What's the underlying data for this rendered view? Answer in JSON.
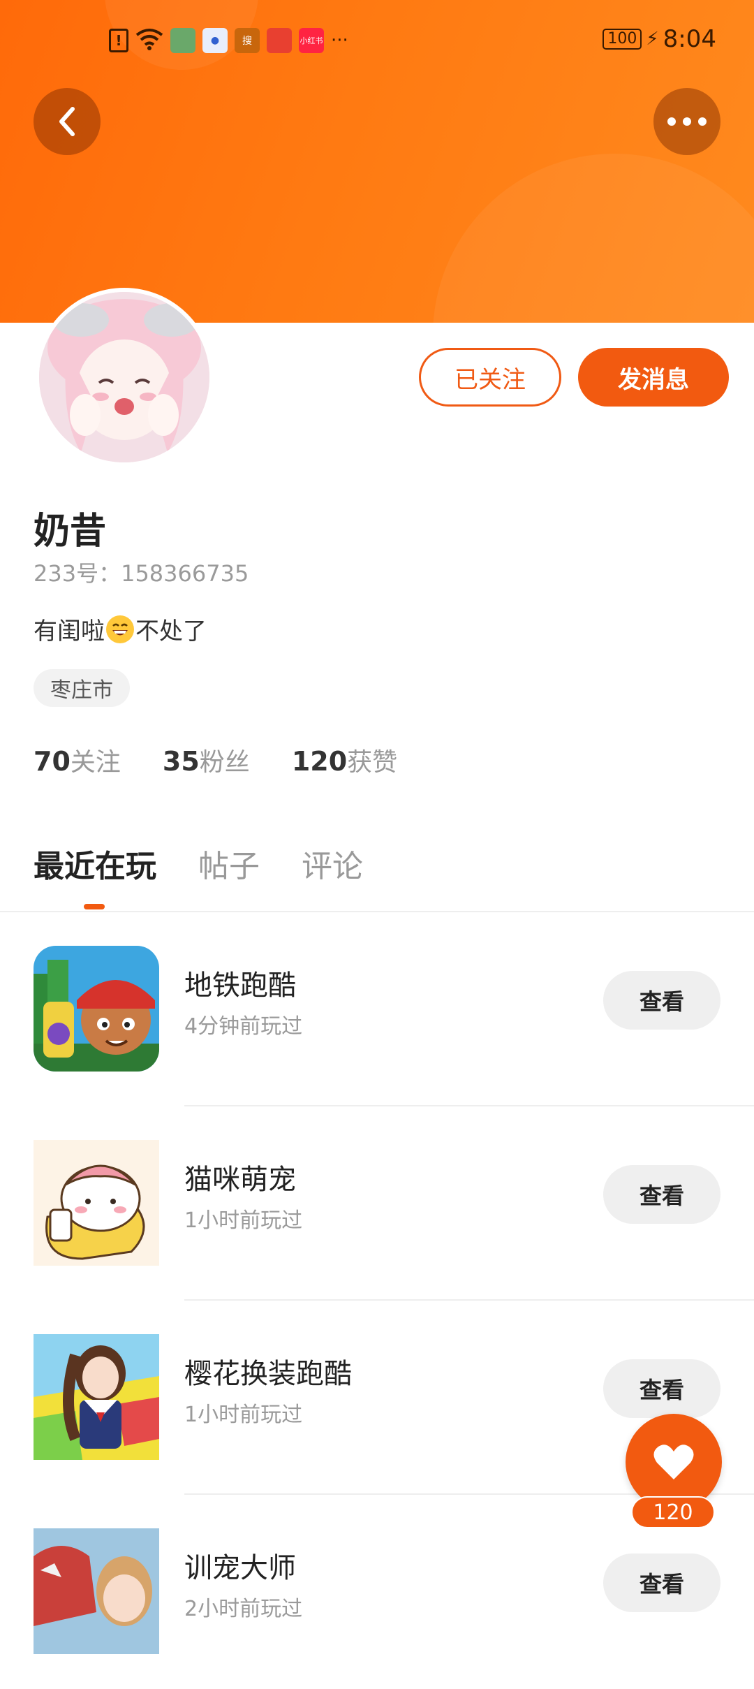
{
  "status_bar": {
    "time": "8:04",
    "battery": "100",
    "more": "···",
    "app_badges": [
      "搜",
      "小红书"
    ]
  },
  "profile": {
    "name": "奶昔",
    "uid": "233号：158366735",
    "bio_before": "有闺啦",
    "bio_after": "不处了",
    "location": "枣庄市",
    "follow_button": "已关注",
    "message_button": "发消息"
  },
  "stats": [
    {
      "value": "70",
      "label": "关注"
    },
    {
      "value": "35",
      "label": "粉丝"
    },
    {
      "value": "120",
      "label": "获赞"
    }
  ],
  "tabs": [
    {
      "label": "最近在玩",
      "active": true
    },
    {
      "label": "帖子",
      "active": false
    },
    {
      "label": "评论",
      "active": false
    }
  ],
  "games": [
    {
      "name": "地铁跑酷",
      "time": "4分钟前玩过",
      "button": "查看"
    },
    {
      "name": "猫咪萌宠",
      "time": "1小时前玩过",
      "button": "查看"
    },
    {
      "name": "樱花换装跑酷",
      "time": "1小时前玩过",
      "button": "查看"
    },
    {
      "name": "训宠大师",
      "time": "2小时前玩过",
      "button": "查看"
    }
  ],
  "fab": {
    "count": "120"
  },
  "colors": {
    "accent": "#f25a10",
    "header": "#ff7a12"
  }
}
